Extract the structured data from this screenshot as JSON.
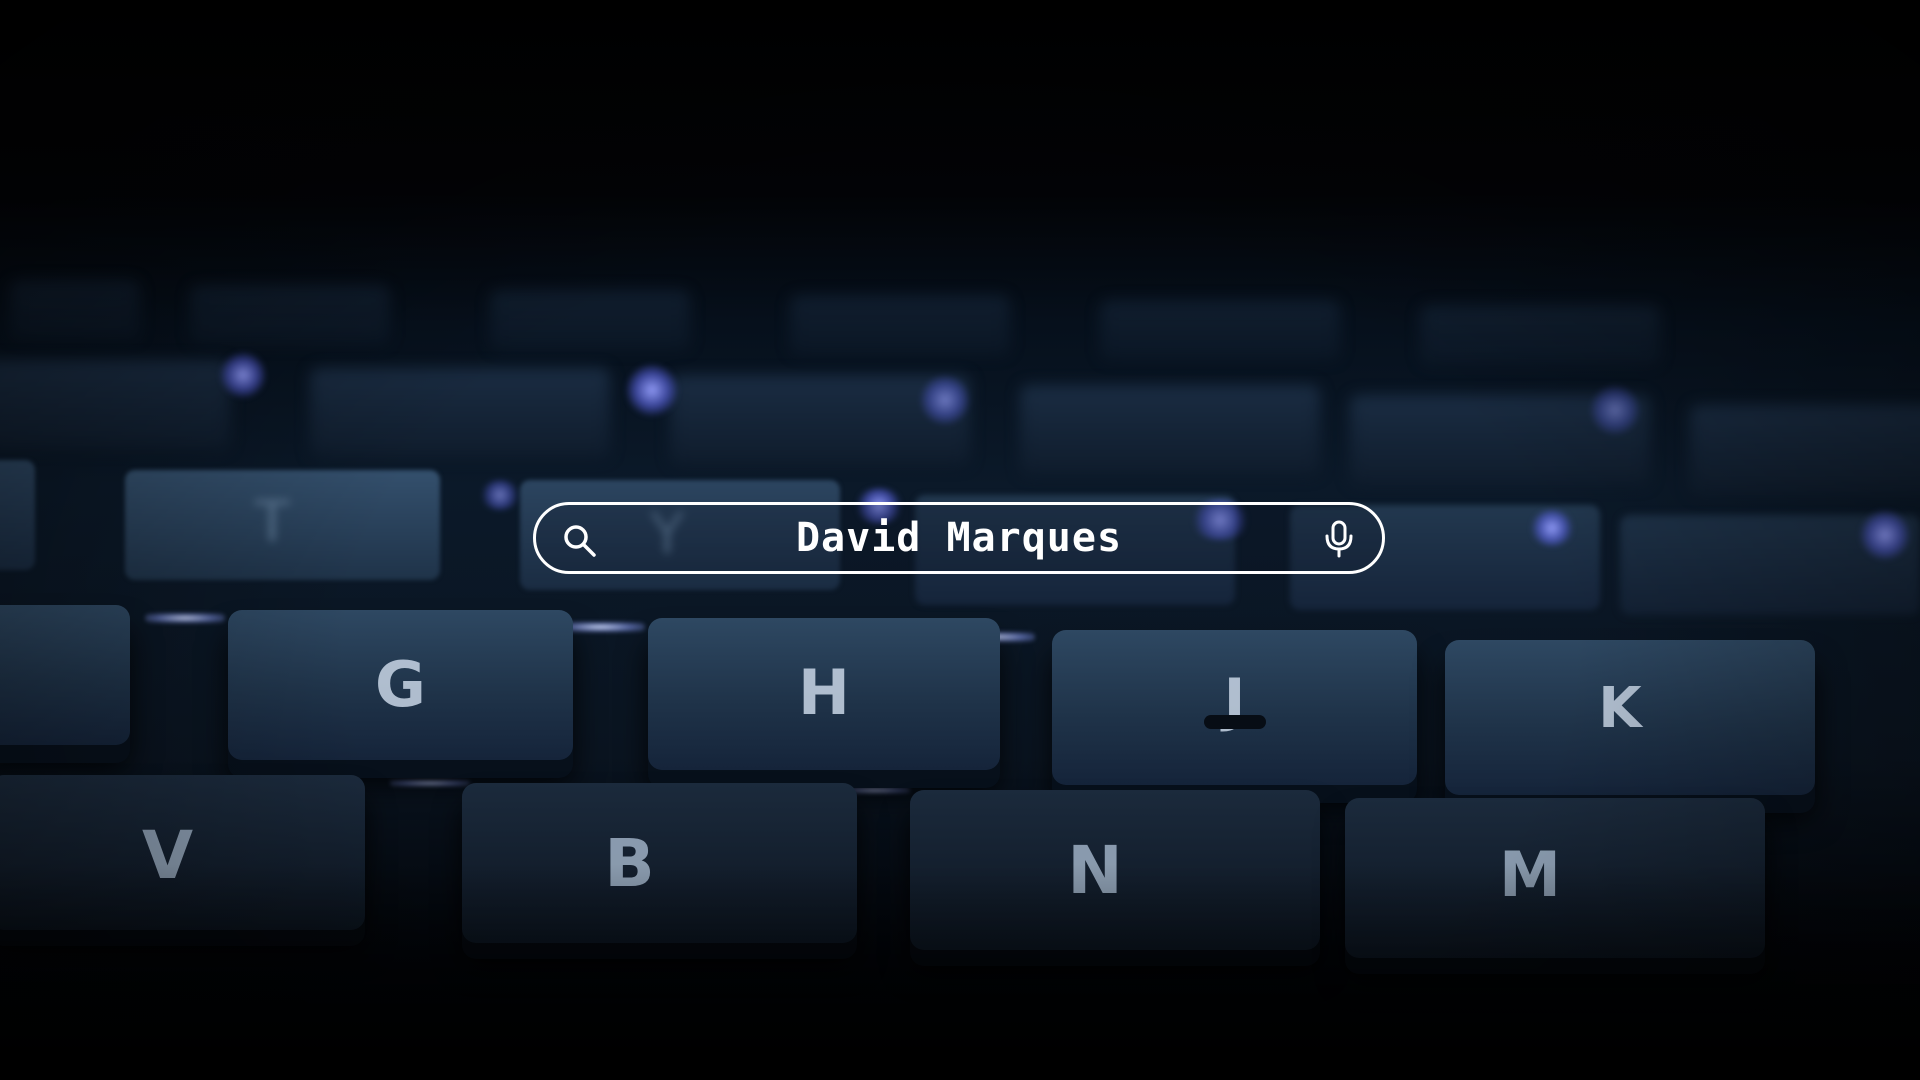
{
  "search": {
    "query": "David Marques",
    "search_icon": "search-icon",
    "mic_icon": "mic-icon"
  },
  "keyboard": {
    "middle_row": [
      "T",
      "Y"
    ],
    "home_row": [
      "G",
      "H",
      "J",
      "K"
    ],
    "bottom_row": [
      "V",
      "B",
      "N",
      "M"
    ]
  },
  "colors": {
    "backlight": "#7f8cff",
    "search_border": "#ffffff",
    "search_text": "#ffffff",
    "key_top": "#2e4862"
  }
}
